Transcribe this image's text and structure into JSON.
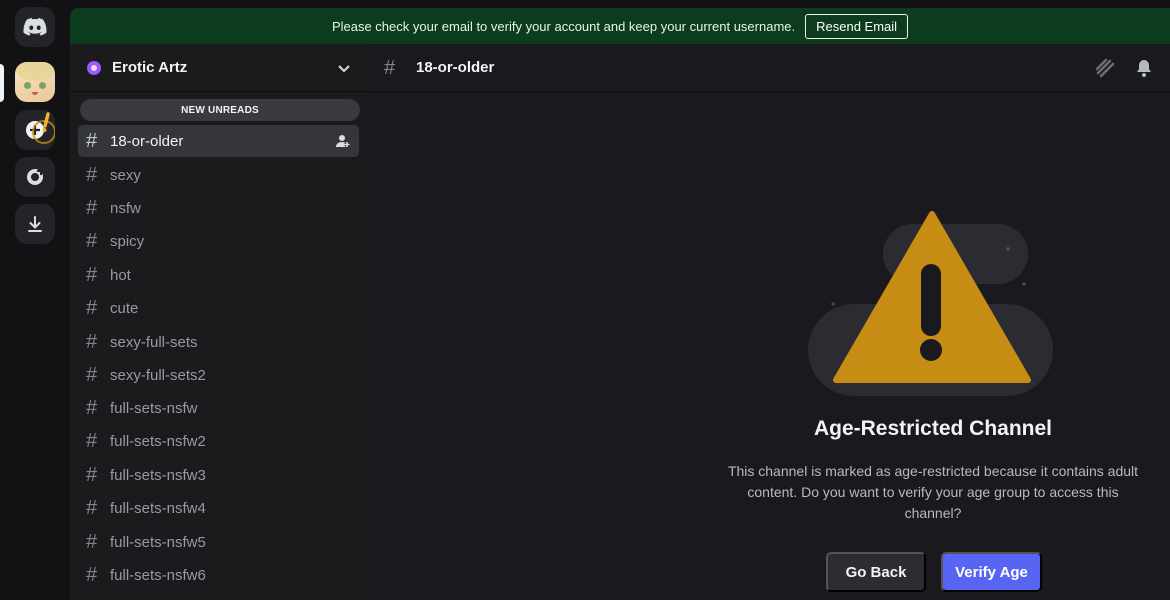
{
  "banner": {
    "message": "Please check your email to verify your account and keep your current username.",
    "button_label": "Resend Email"
  },
  "server": {
    "name": "Erotic Artz",
    "new_unreads_label": "NEW UNREADS"
  },
  "channels": [
    {
      "label": "18-or-older",
      "active": true
    },
    {
      "label": "sexy"
    },
    {
      "label": "nsfw"
    },
    {
      "label": "spicy"
    },
    {
      "label": "hot"
    },
    {
      "label": "cute"
    },
    {
      "label": "sexy-full-sets"
    },
    {
      "label": "sexy-full-sets2"
    },
    {
      "label": "full-sets-nsfw"
    },
    {
      "label": "full-sets-nsfw2"
    },
    {
      "label": "full-sets-nsfw3"
    },
    {
      "label": "full-sets-nsfw4"
    },
    {
      "label": "full-sets-nsfw5"
    },
    {
      "label": "full-sets-nsfw6"
    }
  ],
  "header": {
    "hash": "#",
    "channel_name": "18-or-older"
  },
  "restricted": {
    "title": "Age-Restricted Channel",
    "description": "This channel is marked as age-restricted because it contains adult content. Do you want to verify your age group to access this channel?",
    "go_back_label": "Go Back",
    "verify_label": "Verify Age"
  },
  "icons": [
    "discord-logo-icon",
    "add-server-icon",
    "explore-icon",
    "download-icon",
    "chevron-down-icon",
    "threads-icon",
    "bell-icon",
    "add-member-icon",
    "warning-icon"
  ],
  "colors": {
    "accent": "#5865f2",
    "banner_bg": "#0d3b1d",
    "warning": "#c78c14"
  }
}
